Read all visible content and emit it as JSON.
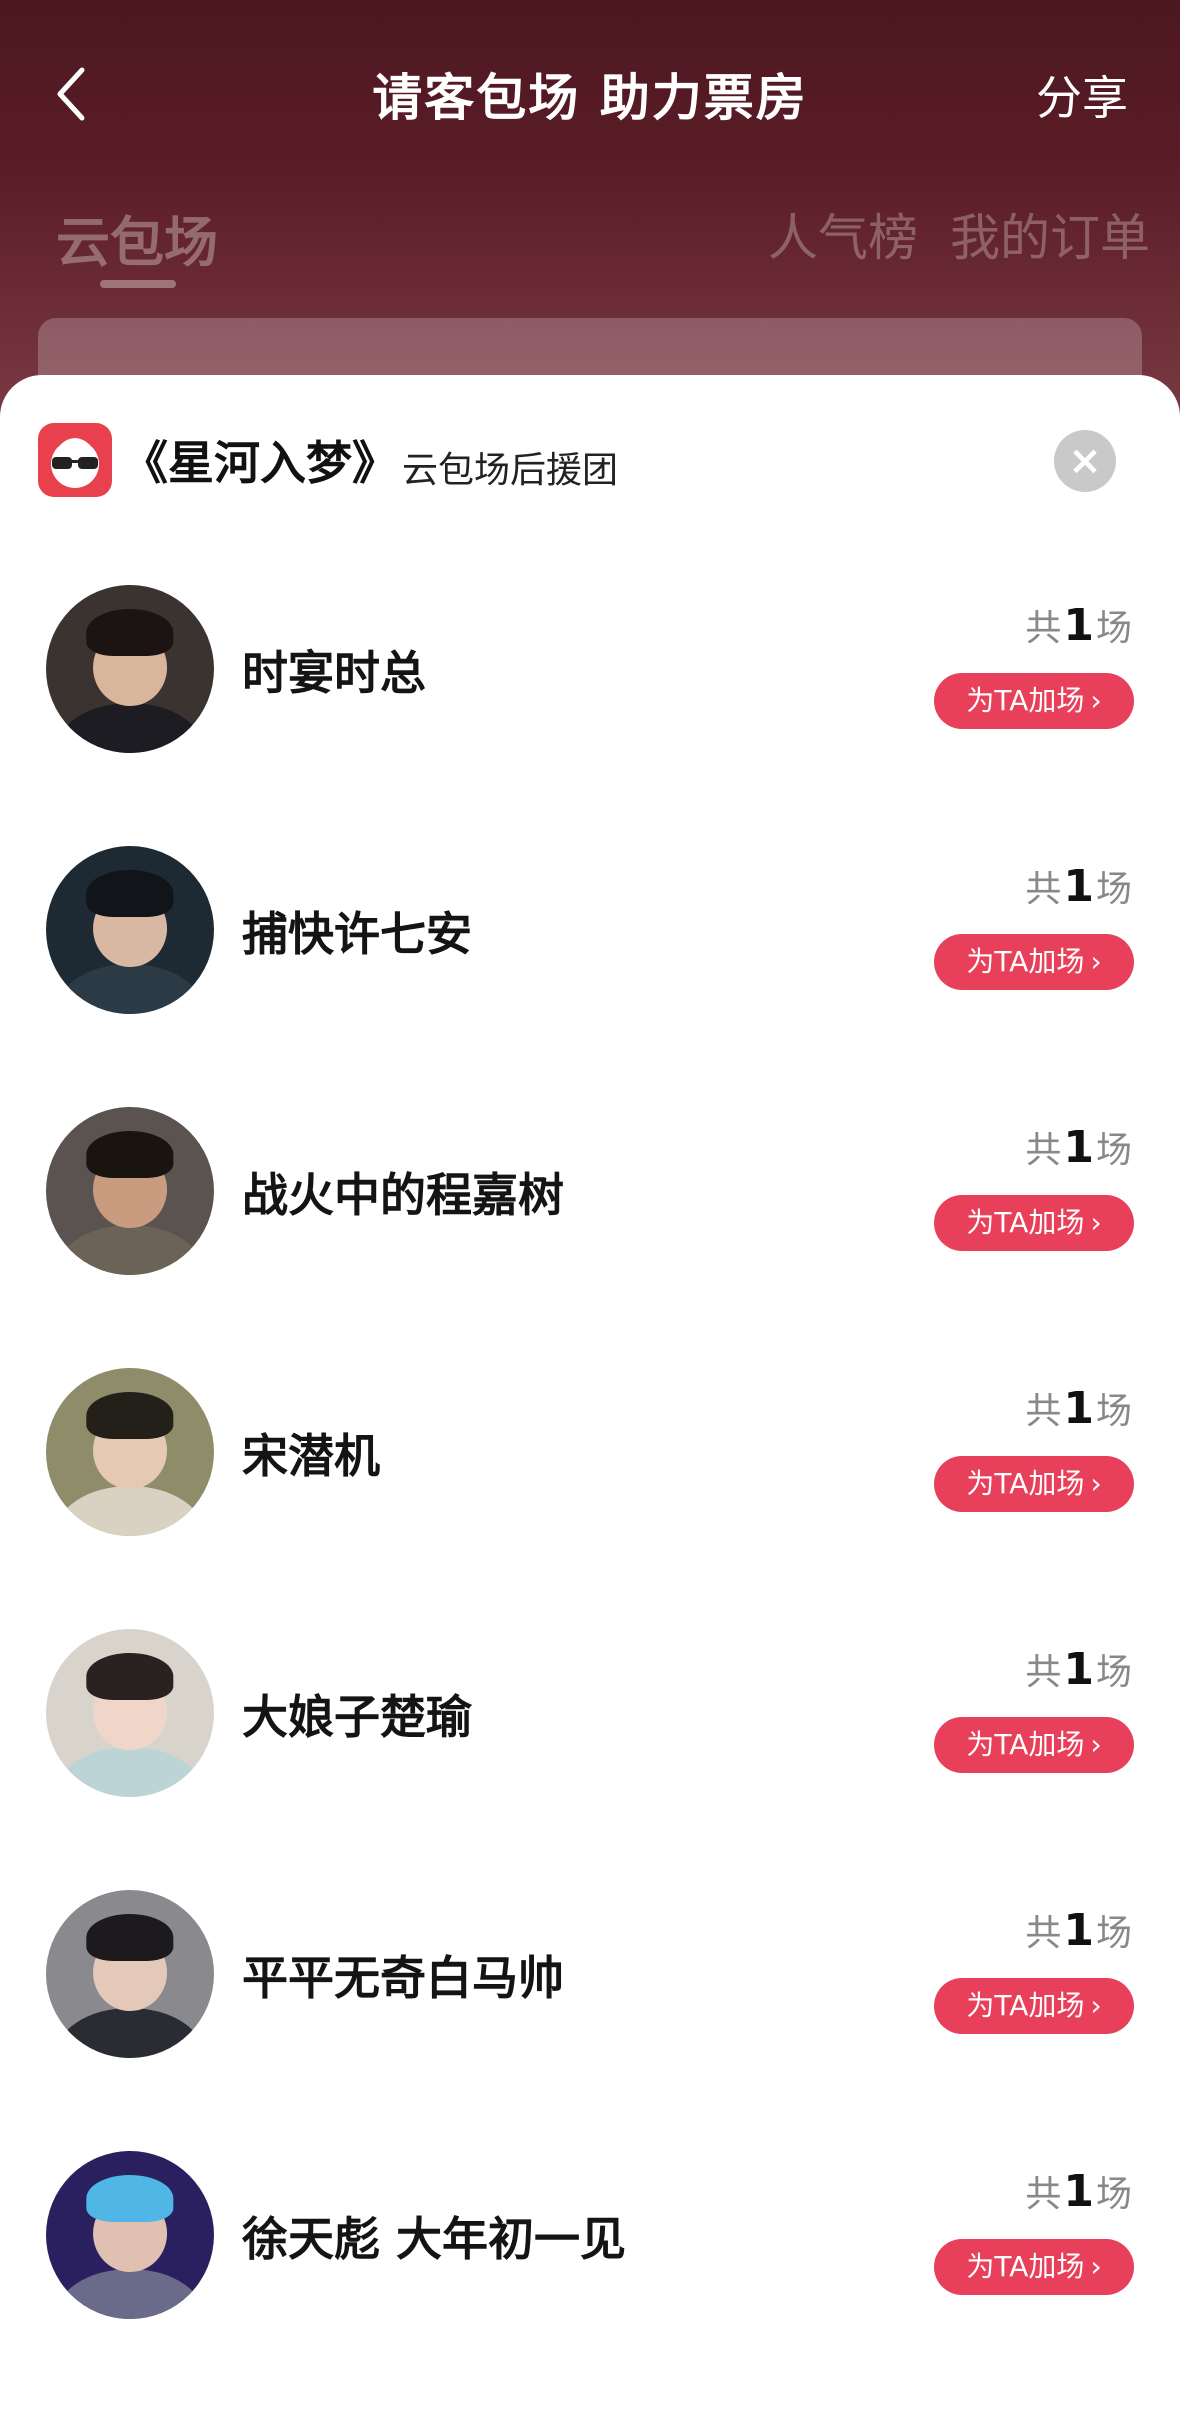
{
  "nav": {
    "title": "请客包场 助力票房",
    "share_label": "分享"
  },
  "tabs": {
    "main": "云包场",
    "rank": "人气榜",
    "orders": "我的订单"
  },
  "sheet": {
    "title": "《星河入梦》",
    "subtitle": "云包场后援团",
    "close_symbol": "×"
  },
  "colors": {
    "accent": "#e8405a",
    "header_bg": "#4d1820"
  },
  "items": [
    {
      "name": "时宴时总",
      "count_prefix": "共",
      "count": "1",
      "count_suffix": "场",
      "button": "为TA加场",
      "chevron": "›"
    },
    {
      "name": "捕快许七安",
      "count_prefix": "共",
      "count": "1",
      "count_suffix": "场",
      "button": "为TA加场",
      "chevron": "›"
    },
    {
      "name": "战火中的程嘉树",
      "count_prefix": "共",
      "count": "1",
      "count_suffix": "场",
      "button": "为TA加场",
      "chevron": "›"
    },
    {
      "name": "宋潜机",
      "count_prefix": "共",
      "count": "1",
      "count_suffix": "场",
      "button": "为TA加场",
      "chevron": "›"
    },
    {
      "name": "大娘子楚瑜",
      "count_prefix": "共",
      "count": "1",
      "count_suffix": "场",
      "button": "为TA加场",
      "chevron": "›"
    },
    {
      "name": "平平无奇白马帅",
      "count_prefix": "共",
      "count": "1",
      "count_suffix": "场",
      "button": "为TA加场",
      "chevron": "›"
    },
    {
      "name": "徐天彪 大年初一见",
      "count_prefix": "共",
      "count": "1",
      "count_suffix": "场",
      "button": "为TA加场",
      "chevron": "›"
    }
  ]
}
